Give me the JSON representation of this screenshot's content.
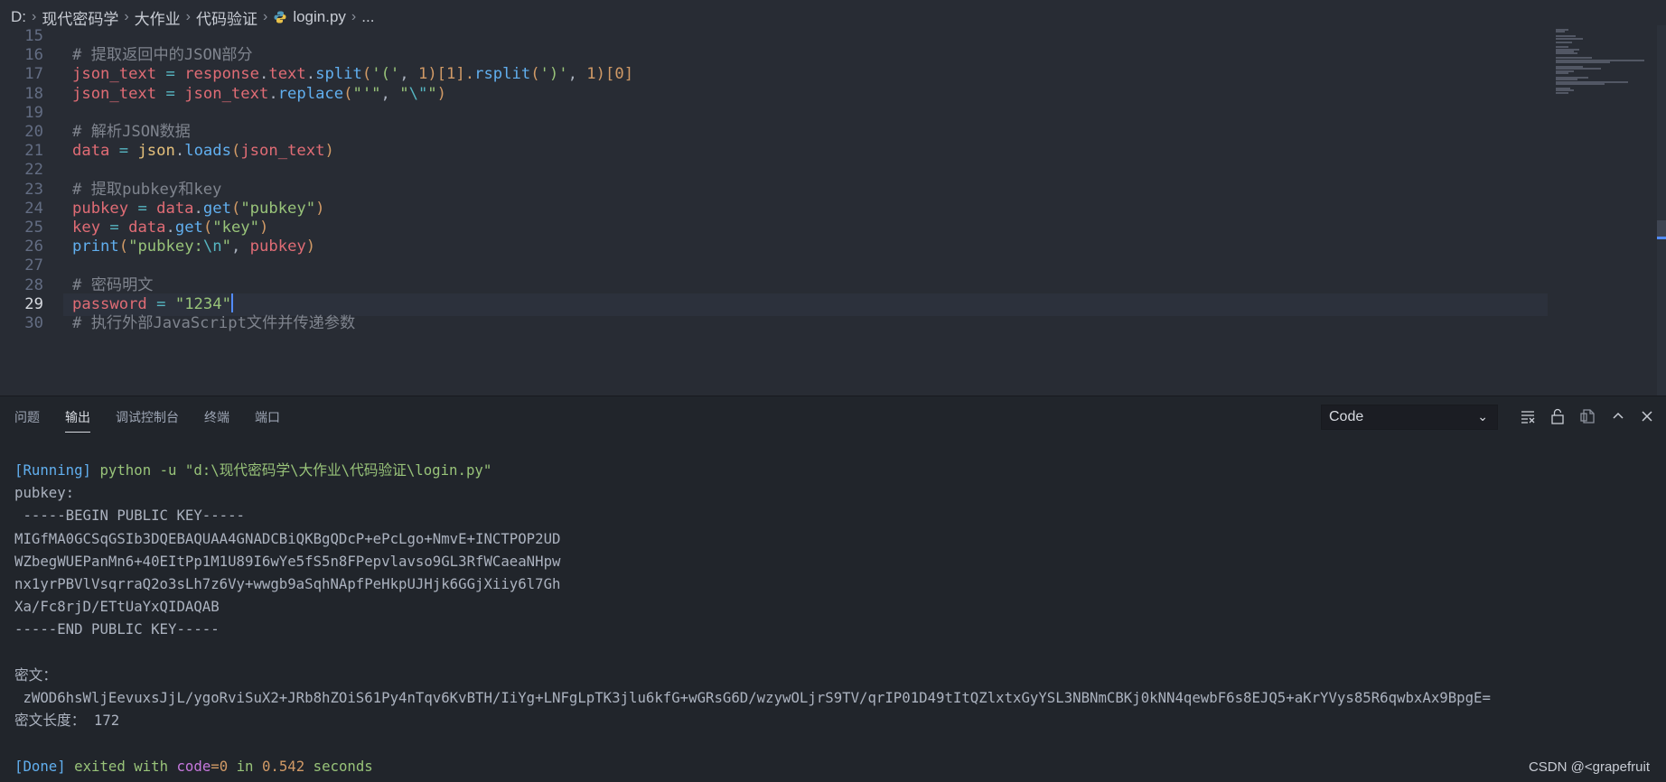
{
  "breadcrumb": {
    "items": [
      "D:",
      "现代密码学",
      "大作业",
      "代码验证",
      "login.py",
      "..."
    ]
  },
  "editor": {
    "lines": [
      {
        "num": "15",
        "tokens": []
      },
      {
        "num": "16",
        "tokens": [
          {
            "t": "# 提取返回中的JSON部分",
            "c": "comment"
          }
        ]
      },
      {
        "num": "17",
        "tokens": [
          {
            "t": "json_text",
            "c": "var"
          },
          {
            "t": " = ",
            "c": "op"
          },
          {
            "t": "response",
            "c": "var"
          },
          {
            "t": ".",
            "c": "plain"
          },
          {
            "t": "text",
            "c": "var"
          },
          {
            "t": ".",
            "c": "plain"
          },
          {
            "t": "split",
            "c": "fn"
          },
          {
            "t": "(",
            "c": "num"
          },
          {
            "t": "'('",
            "c": "str"
          },
          {
            "t": ", ",
            "c": "plain"
          },
          {
            "t": "1",
            "c": "num"
          },
          {
            "t": ")[",
            "c": "num"
          },
          {
            "t": "1",
            "c": "num"
          },
          {
            "t": "].",
            "c": "num"
          },
          {
            "t": "rsplit",
            "c": "fn"
          },
          {
            "t": "(",
            "c": "num"
          },
          {
            "t": "')'",
            "c": "str"
          },
          {
            "t": ", ",
            "c": "plain"
          },
          {
            "t": "1",
            "c": "num"
          },
          {
            "t": ")[",
            "c": "num"
          },
          {
            "t": "0",
            "c": "num"
          },
          {
            "t": "]",
            "c": "num"
          }
        ]
      },
      {
        "num": "18",
        "tokens": [
          {
            "t": "json_text",
            "c": "var"
          },
          {
            "t": " = ",
            "c": "op"
          },
          {
            "t": "json_text",
            "c": "var"
          },
          {
            "t": ".",
            "c": "plain"
          },
          {
            "t": "replace",
            "c": "fn"
          },
          {
            "t": "(",
            "c": "num"
          },
          {
            "t": "\"'\"",
            "c": "str"
          },
          {
            "t": ", ",
            "c": "plain"
          },
          {
            "t": "\"",
            "c": "str"
          },
          {
            "t": "\\\"",
            "c": "esc"
          },
          {
            "t": "\"",
            "c": "str"
          },
          {
            "t": ")",
            "c": "num"
          }
        ]
      },
      {
        "num": "19",
        "tokens": []
      },
      {
        "num": "20",
        "tokens": [
          {
            "t": "# 解析JSON数据",
            "c": "comment"
          }
        ]
      },
      {
        "num": "21",
        "tokens": [
          {
            "t": "data",
            "c": "var"
          },
          {
            "t": " = ",
            "c": "op"
          },
          {
            "t": "json",
            "c": "obj"
          },
          {
            "t": ".",
            "c": "plain"
          },
          {
            "t": "loads",
            "c": "fn"
          },
          {
            "t": "(",
            "c": "num"
          },
          {
            "t": "json_text",
            "c": "var"
          },
          {
            "t": ")",
            "c": "num"
          }
        ]
      },
      {
        "num": "22",
        "tokens": []
      },
      {
        "num": "23",
        "tokens": [
          {
            "t": "# 提取pubkey和key",
            "c": "comment"
          }
        ]
      },
      {
        "num": "24",
        "tokens": [
          {
            "t": "pubkey",
            "c": "var"
          },
          {
            "t": " = ",
            "c": "op"
          },
          {
            "t": "data",
            "c": "var"
          },
          {
            "t": ".",
            "c": "plain"
          },
          {
            "t": "get",
            "c": "fn"
          },
          {
            "t": "(",
            "c": "num"
          },
          {
            "t": "\"pubkey\"",
            "c": "str"
          },
          {
            "t": ")",
            "c": "num"
          }
        ]
      },
      {
        "num": "25",
        "tokens": [
          {
            "t": "key",
            "c": "var"
          },
          {
            "t": " = ",
            "c": "op"
          },
          {
            "t": "data",
            "c": "var"
          },
          {
            "t": ".",
            "c": "plain"
          },
          {
            "t": "get",
            "c": "fn"
          },
          {
            "t": "(",
            "c": "num"
          },
          {
            "t": "\"key\"",
            "c": "str"
          },
          {
            "t": ")",
            "c": "num"
          }
        ]
      },
      {
        "num": "26",
        "tokens": [
          {
            "t": "print",
            "c": "fn"
          },
          {
            "t": "(",
            "c": "num"
          },
          {
            "t": "\"pubkey:",
            "c": "str"
          },
          {
            "t": "\\n",
            "c": "esc"
          },
          {
            "t": "\"",
            "c": "str"
          },
          {
            "t": ", ",
            "c": "plain"
          },
          {
            "t": "pubkey",
            "c": "var"
          },
          {
            "t": ")",
            "c": "num"
          }
        ]
      },
      {
        "num": "27",
        "tokens": []
      },
      {
        "num": "28",
        "tokens": [
          {
            "t": "# 密码明文",
            "c": "comment"
          }
        ]
      },
      {
        "num": "29",
        "active": true,
        "tokens": [
          {
            "t": "password",
            "c": "var"
          },
          {
            "t": " = ",
            "c": "op"
          },
          {
            "t": "\"1234\"",
            "c": "str"
          }
        ]
      },
      {
        "num": "30",
        "tokens": [
          {
            "t": "# 执行外部JavaScript文件并传递参数",
            "c": "comment"
          }
        ]
      }
    ]
  },
  "panel": {
    "tabs": [
      "问题",
      "输出",
      "调试控制台",
      "终端",
      "端口"
    ],
    "active_tab": "输出",
    "channel": "Code"
  },
  "output": {
    "running_tag": "[Running]",
    "command": "python -u \"d:\\现代密码学\\大作业\\代码验证\\login.py\"",
    "lines": [
      "pubkey:",
      " -----BEGIN PUBLIC KEY-----",
      "MIGfMA0GCSqGSIb3DQEBAQUAA4GNADCBiQKBgQDcP+ePcLgo+NmvE+INCTPOP2UD",
      "WZbegWUEPanMn6+40EItPp1M1U89I6wYe5fS5n8FPepvlavso9GL3RfWCaeaNHpw",
      "nx1yrPBVlVsqrraQ2o3sLh7z6Vy+wwgb9aSqhNApfPeHkpUJHjk6GGjXiiy6l7Gh",
      "Xa/Fc8rjD/ETtUaYxQIDAQAB",
      "-----END PUBLIC KEY-----",
      "",
      "密文：",
      " zWOD6hsWljEevuxsJjL/ygoRviSuX2+JRb8hZOiS61Py4nTqv6KvBTH/IiYg+LNFgLpTK3jlu6kfG+wGRsG6D/wzywOLjrS9TV/qrIP01D49tItQZlxtxGyYSL3NBNmCBKj0kNN4qewbF6s8EJQ5+aKrYVys85R6qwbxAx9BpgE=",
      "密文长度： 172",
      ""
    ],
    "done_tag": "[Done]",
    "done_text": "exited with",
    "code_label": "code",
    "code_value": "=0",
    "in_text": "in",
    "seconds_value": "0.542",
    "seconds_label": "seconds"
  },
  "watermark": "CSDN @<grapefruit",
  "colors": {
    "editor_bg": "#282c34",
    "panel_bg": "#21252b",
    "accent": "#528bff"
  }
}
